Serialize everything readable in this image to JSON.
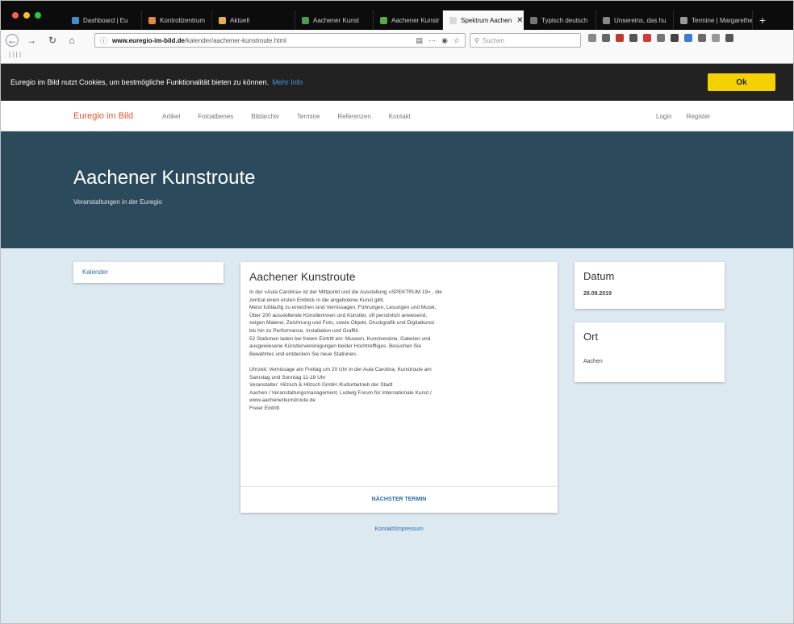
{
  "browser": {
    "tabs": [
      {
        "label": "Dashboard | Eu",
        "fav": "#3f8fd2"
      },
      {
        "label": "Kontrollzentrum",
        "fav": "#e3893a"
      },
      {
        "label": "Aktuell",
        "fav": "#e9b04a"
      },
      {
        "label": "Aachener Kunst",
        "fav": "#4a9c55"
      },
      {
        "label": "Aachener Kunstr",
        "fav": "#5ba84a"
      },
      {
        "label": "Spektrum Aachen",
        "fav": "#d9d9d9",
        "active": true,
        "close": "✕"
      },
      {
        "label": "Typisch deutsch",
        "fav": "#777777"
      },
      {
        "label": "Unsereins, das hu",
        "fav": "#888888"
      },
      {
        "label": "Termine | Margarethe",
        "fav": "#999999"
      }
    ],
    "new_tab": "+",
    "url_host": "www.euregio-im-bild.de",
    "url_path": "/kalender/aachener-kunstroute.html",
    "search_placeholder": "Suchen",
    "bookmarks_label": "| | | |"
  },
  "cookie_banner": {
    "text": "Euregio im Bild nutzt Cookies, um bestmögliche Funktionalität bieten zu können.",
    "more_link": "Mehr Info",
    "ok_label": "Ok"
  },
  "site_nav": {
    "brand": "Euregio im Bild",
    "links": [
      "Artikel",
      "Fotoalbenes",
      "Bildarchiv",
      "Termine",
      "Referenzen",
      "Kontakt"
    ],
    "login": "Login",
    "register": "Register"
  },
  "hero": {
    "title": "Aachener Kunstroute",
    "subtitle": "Veranstaltungen in der Euregio"
  },
  "sidebar": {
    "link": "Kalender"
  },
  "event": {
    "title": "Aachener Kunstroute",
    "paragraph1": "In der »Aula Carolina« ist der Mittpunkt und die Ausstellung »SPEKTRUM 19« , die\nzentral einen ersten Einblick in die angebotene Kunst gibt.\nMeist fußläufig zu erreichen sind Vernissagen, Führungen, Lesungen und Musik.\nÜber 200 ausstellende Künstlerinnen und Künstler, oft persönlich anwesend,\nzeigen Malerei, Zeichnung und Foto, sowie Objekt, Druckgrafik und Digitalkunst\nbis hin zu Performance, Installation und Graffiti.\n52 Stationen laden bei freiem Eintritt ein: Museen, Kunstvereine, Galerien und\nausgewiesene Künstlervereinigungen beider Hochtreffliges. Besuchen Sie\nBewährtes und entdecken Sie neue Stationen.",
    "paragraph2": "Uhrzeit: Vernissage am Freitag um 20 Uhr in der Aula Carolina, Kunstroute am\nSamstag und Sonntag 11-18 Uhr\nVeranstalter: Hilzsch & Hilzsch GmbH /Kulturbetrieb der Stadt\nAachen / Veranstaltungsmanagement, Ludwig Forum für Internationale Kunst /\nwww.aachenerkunstroute.de\nFreier Eintritt",
    "next_label": "NÄCHSTER TERMIN"
  },
  "datum": {
    "title": "Datum",
    "value": "28.09.2019"
  },
  "ort": {
    "title": "Ort",
    "value": "Aachen"
  },
  "footer": {
    "link": "Kontakt/Impressum"
  },
  "colors": {
    "hero_bg": "#2b4a5c",
    "content_bg": "#dde9f1",
    "brand": "#e0552f",
    "link": "#2e6da4",
    "ok_button": "#f4d100"
  }
}
